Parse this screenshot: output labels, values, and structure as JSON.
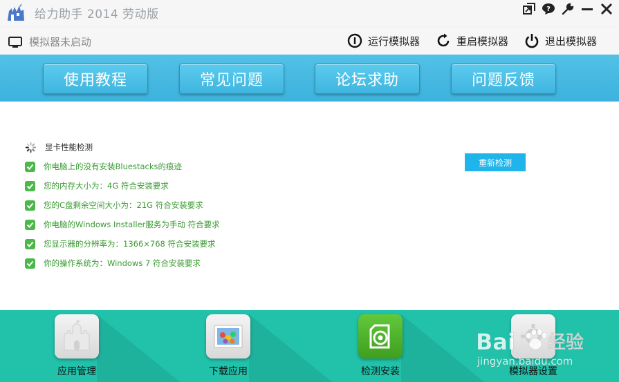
{
  "window": {
    "title": "给力助手 2014 劳动版",
    "controls": [
      "restore-icon",
      "feedback-bubble-icon",
      "wrench-icon",
      "minimize-icon",
      "close-icon"
    ]
  },
  "statusbar": {
    "emulator_status": "模拟器未启动",
    "run_label": "运行模拟器",
    "restart_label": "重启模拟器",
    "exit_label": "退出模拟器"
  },
  "banner": {
    "tabs": [
      {
        "label": "使用教程"
      },
      {
        "label": "常见问题"
      },
      {
        "label": "论坛求助"
      },
      {
        "label": "问题反馈"
      }
    ]
  },
  "checks": {
    "header": "显卡性能检测",
    "items": [
      {
        "text": "你电脑上的没有安装Bluestacks的痕迹",
        "status": "ok"
      },
      {
        "text": "您的内存大小为：4G 符合安装要求",
        "status": "ok"
      },
      {
        "text": "您的C盘剩余空间大小为：21G 符合安装要求",
        "status": "ok"
      },
      {
        "text": "你电脑的Windows Installer服务为手动 符合要求",
        "status": "ok"
      },
      {
        "text": "您显示器的分辨率为：1366×768 符合安装要求",
        "status": "ok"
      },
      {
        "text": "你的操作系统为：Windows 7 符合安装要求",
        "status": "ok"
      }
    ],
    "recheck_label": "重新检测"
  },
  "toolbar": {
    "items": [
      {
        "label": "应用管理",
        "icon": "castle-app-icon"
      },
      {
        "label": "下载应用",
        "icon": "download-photo-icon"
      },
      {
        "label": "检测安装",
        "icon": "detect-install-icon"
      },
      {
        "label": "模拟器设置",
        "icon": "emulator-settings-icon"
      }
    ]
  },
  "watermark": {
    "brand": "Bai",
    "suffix": "经验",
    "url": "jingyan.baidu.com"
  },
  "colors": {
    "banner": "#3cb2dd",
    "bottom_bar": "#21c1aa",
    "ok_text": "#3a9a32",
    "check_icon": "#4cb84a",
    "recheck_button": "#1fb4ea"
  }
}
